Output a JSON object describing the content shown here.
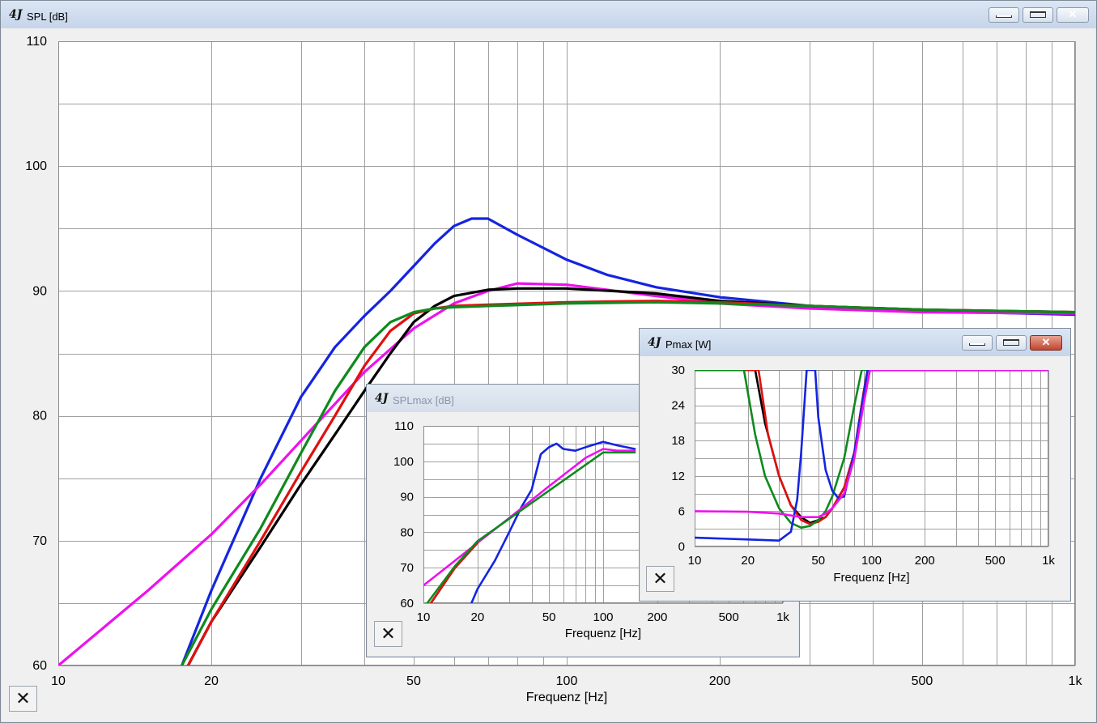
{
  "app_logo": "4J",
  "windows": {
    "spl": {
      "title": "SPL [dB]"
    },
    "splmax": {
      "title": "SPLmax [dB]"
    },
    "pmax": {
      "title": "Pmax [W]"
    }
  },
  "window_buttons": {
    "min": "",
    "max": "",
    "close": "✕"
  },
  "close_button_label": "✕",
  "icons": {
    "min": "minimize-icon",
    "max": "maximize-icon",
    "close": "close-icon",
    "logo": "app-logo-icon"
  },
  "series_colors": {
    "black": "#000000",
    "red": "#e01010",
    "green": "#0e8a1e",
    "blue": "#1424e0",
    "magenta": "#ee10ee"
  },
  "chart_data": [
    {
      "id": "spl",
      "type": "line",
      "title": "SPL [dB]",
      "xlabel": "Frequenz [Hz]",
      "ylabel": "",
      "xscale": "log",
      "xlim": [
        10,
        1000
      ],
      "ylim": [
        60,
        110
      ],
      "xticks": [
        10,
        20,
        50,
        100,
        200,
        500,
        1000
      ],
      "xtick_labels": [
        "10",
        "20",
        "50",
        "100",
        "200",
        "500",
        "1k"
      ],
      "yticks": [
        60,
        70,
        80,
        90,
        100,
        110
      ],
      "ytick_labels": [
        "60",
        "70",
        "80",
        "90",
        "100",
        "110"
      ],
      "grid": true,
      "series": [
        {
          "color": "#1424e0",
          "x": [
            17.5,
            20,
            25,
            30,
            35,
            40,
            45,
            50,
            55,
            60,
            65,
            70,
            80,
            100,
            120,
            150,
            200,
            300,
            500,
            1000
          ],
          "y": [
            60,
            66,
            75,
            81.5,
            85.5,
            88,
            90,
            92,
            93.8,
            95.2,
            95.8,
            95.8,
            94.5,
            92.5,
            91.3,
            90.3,
            89.5,
            88.8,
            88.4,
            88.1
          ]
        },
        {
          "color": "#ee10ee",
          "x": [
            10,
            15,
            20,
            25,
            30,
            40,
            50,
            60,
            70,
            80,
            100,
            150,
            200,
            300,
            500,
            1000
          ],
          "y": [
            60,
            66,
            70.5,
            74.5,
            78,
            83.5,
            87,
            89,
            90,
            90.6,
            90.5,
            89.6,
            89,
            88.6,
            88.3,
            88.2
          ]
        },
        {
          "color": "#000000",
          "x": [
            18,
            20,
            25,
            30,
            35,
            40,
            45,
            50,
            55,
            60,
            70,
            80,
            100,
            150,
            200,
            300,
            500,
            1000
          ],
          "y": [
            60,
            63.5,
            69.5,
            74.5,
            78.5,
            82,
            85,
            87.5,
            88.8,
            89.6,
            90.1,
            90.2,
            90.2,
            89.8,
            89.2,
            88.8,
            88.5,
            88.3
          ]
        },
        {
          "color": "#e01010",
          "x": [
            18,
            20,
            25,
            30,
            35,
            40,
            45,
            50,
            55,
            60,
            70,
            100,
            150,
            200,
            300,
            500,
            1000
          ],
          "y": [
            60,
            63.5,
            70,
            75.5,
            80,
            84,
            86.8,
            88.2,
            88.6,
            88.8,
            88.9,
            89.1,
            89.2,
            89.1,
            88.8,
            88.5,
            88.3
          ]
        },
        {
          "color": "#0e8a1e",
          "x": [
            17.5,
            20,
            25,
            30,
            35,
            40,
            45,
            50,
            55,
            60,
            70,
            100,
            150,
            200,
            300,
            500,
            1000
          ],
          "y": [
            60,
            64.5,
            71,
            77,
            82,
            85.5,
            87.5,
            88.3,
            88.6,
            88.7,
            88.8,
            89.0,
            89.1,
            89.0,
            88.8,
            88.5,
            88.3
          ]
        }
      ]
    },
    {
      "id": "splmax",
      "type": "line",
      "title": "SPLmax [dB]",
      "xlabel": "Frequenz [Hz]",
      "ylabel": "",
      "xscale": "log",
      "xlim": [
        10,
        1000
      ],
      "ylim": [
        60,
        110
      ],
      "xticks": [
        10,
        20,
        50,
        100,
        200,
        500,
        1000
      ],
      "xtick_labels": [
        "10",
        "20",
        "50",
        "100",
        "200",
        "500",
        "1k"
      ],
      "yticks": [
        60,
        70,
        80,
        90,
        100,
        110
      ],
      "ytick_labels": [
        "60",
        "70",
        "80",
        "90",
        "100",
        "110"
      ],
      "grid": true,
      "series": [
        {
          "color": "#1424e0",
          "x": [
            18.5,
            20,
            25,
            30,
            35,
            40,
            45,
            50,
            55,
            60,
            70,
            80,
            100,
            120,
            150
          ],
          "y": [
            60,
            64,
            72,
            80,
            87,
            92,
            102,
            104,
            105,
            103.5,
            103,
            104,
            105.5,
            104.5,
            103.5
          ]
        },
        {
          "color": "#ee10ee",
          "x": [
            10,
            15,
            20,
            30,
            50,
            80,
            100,
            120,
            150
          ],
          "y": [
            65,
            72,
            77,
            84,
            93,
            101,
            103.5,
            103,
            103
          ]
        },
        {
          "color": "#000000",
          "x": [
            11,
            15,
            20
          ],
          "y": [
            60,
            70,
            77
          ]
        },
        {
          "color": "#e01010",
          "x": [
            11,
            15,
            20
          ],
          "y": [
            60,
            70,
            77
          ]
        },
        {
          "color": "#0e8a1e",
          "x": [
            10.5,
            15,
            20,
            100,
            150
          ],
          "y": [
            60,
            70.5,
            77.5,
            102.5,
            102.5
          ]
        }
      ]
    },
    {
      "id": "pmax",
      "type": "line",
      "title": "Pmax [W]",
      "xlabel": "Frequenz [Hz]",
      "ylabel": "",
      "xscale": "log",
      "xlim": [
        10,
        1000
      ],
      "ylim": [
        0,
        30
      ],
      "xticks": [
        10,
        20,
        50,
        100,
        200,
        500,
        1000
      ],
      "xtick_labels": [
        "10",
        "20",
        "50",
        "100",
        "200",
        "500",
        "1k"
      ],
      "yticks": [
        0,
        6,
        12,
        18,
        24,
        30
      ],
      "ytick_labels": [
        "0",
        "6",
        "12",
        "18",
        "24",
        "30"
      ],
      "grid": true,
      "series": [
        {
          "color": "#000000",
          "x": [
            10,
            22,
            25,
            30,
            35,
            40,
            45,
            50,
            55,
            60,
            70,
            80,
            90,
            95,
            1000
          ],
          "y": [
            30,
            30,
            21,
            12,
            7,
            5,
            4,
            4.5,
            5,
            6.5,
            10,
            16,
            26,
            30,
            30
          ]
        },
        {
          "color": "#e01010",
          "x": [
            10,
            23,
            26,
            30,
            35,
            40,
            45,
            50,
            55,
            60,
            70,
            80,
            90,
            95,
            1000
          ],
          "y": [
            30,
            30,
            19,
            12,
            7,
            4.5,
            3.8,
            4.2,
            5,
            6.5,
            10,
            16,
            26,
            30,
            30
          ]
        },
        {
          "color": "#0e8a1e",
          "x": [
            10,
            19,
            22,
            25,
            30,
            35,
            40,
            45,
            50,
            55,
            60,
            70,
            80,
            88,
            1000
          ],
          "y": [
            30,
            30,
            19,
            12,
            6.5,
            4,
            3.2,
            3.5,
            4.5,
            6,
            8.5,
            15,
            24,
            30,
            30
          ]
        },
        {
          "color": "#1424e0",
          "x": [
            10,
            20,
            30,
            35,
            38,
            40,
            43,
            45,
            48,
            50,
            55,
            60,
            65,
            70,
            80,
            95,
            1000
          ],
          "y": [
            1.5,
            1.2,
            1.0,
            2.5,
            8,
            16,
            30,
            30,
            30,
            22,
            13,
            9.5,
            8.2,
            8.5,
            16,
            30,
            30
          ]
        },
        {
          "color": "#ee10ee",
          "x": [
            10,
            20,
            30,
            40,
            50,
            55,
            60,
            70,
            80,
            90,
            98,
            1000
          ],
          "y": [
            6,
            5.9,
            5.6,
            5.0,
            5.0,
            5.6,
            6.5,
            9,
            15,
            24,
            30,
            30
          ]
        }
      ]
    }
  ]
}
